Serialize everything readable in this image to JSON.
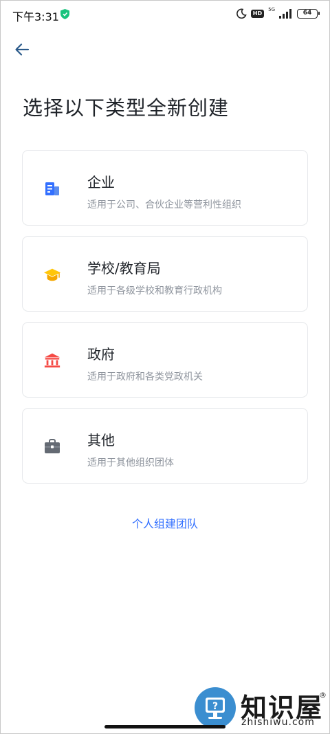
{
  "status_bar": {
    "time": "下午3:31",
    "hd_badge": "HD",
    "network": "5G",
    "battery": "64",
    "icons": [
      "shield-icon",
      "moon-icon",
      "signal-icon",
      "battery-icon"
    ]
  },
  "header": {
    "back_icon": "arrow-left-icon",
    "title": "选择以下类型全新创建"
  },
  "options": [
    {
      "title": "企业",
      "desc": "适用于公司、合伙企业等营利性组织",
      "icon": "building-icon",
      "color": "#3370ff"
    },
    {
      "title": "学校/教育局",
      "desc": "适用于各级学校和教育行政机构",
      "icon": "graduation-cap-icon",
      "color": "#ffc60a"
    },
    {
      "title": "政府",
      "desc": "适用于政府和各类党政机关",
      "icon": "government-icon",
      "color": "#f54a45"
    },
    {
      "title": "其他",
      "desc": "适用于其他组织团体",
      "icon": "briefcase-icon",
      "color": "#646a73"
    }
  ],
  "personal_link": "个人组建团队",
  "watermark": {
    "text": "知识屋",
    "domain": "zhishiwu.com",
    "reg": "®"
  },
  "colors": {
    "accent": "#3370ff",
    "title_text": "#1f2329",
    "desc_text": "#8f959e",
    "card_border": "#e6e8eb"
  }
}
